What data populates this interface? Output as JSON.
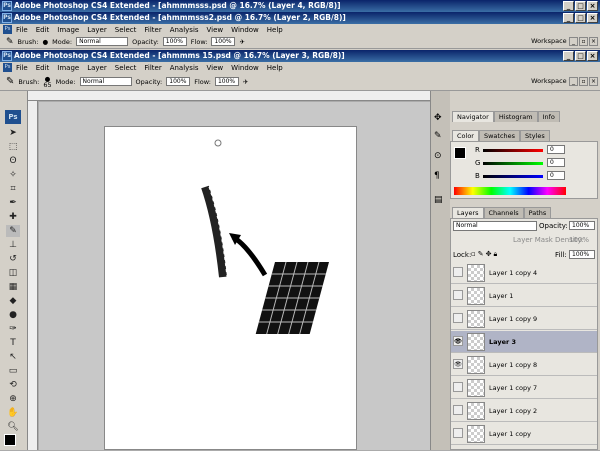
{
  "windows": [
    {
      "title": "Adobe Photoshop CS4 Extended - [ahmmmsss.psd @ 16.7% (Layer 4, RGB/8)]"
    },
    {
      "title": "Adobe Photoshop CS4 Extended - [ahmmmsss2.psd @ 16.7% (Layer 2, RGB/8)]"
    },
    {
      "title": "Adobe Photoshop CS4 Extended - [ahmmms 15.psd @ 16.7% (Layer 3, RGB/8)]"
    }
  ],
  "menu": [
    "File",
    "Edit",
    "Image",
    "Layer",
    "Select",
    "Filter",
    "Analysis",
    "View",
    "Window",
    "Help"
  ],
  "options": {
    "brush_label": "Brush:",
    "brush_size": "65",
    "mode_label": "Mode:",
    "mode_value": "Normal",
    "opacity_label": "Opacity:",
    "opacity_value": "100%",
    "flow_label": "Flow:",
    "flow_value": "100%",
    "workspace": "Workspace ▾"
  },
  "navigator_tabs": [
    "Navigator",
    "Histogram",
    "Info"
  ],
  "color_tabs": [
    "Color",
    "Swatches",
    "Styles"
  ],
  "color": {
    "r_label": "R",
    "g_label": "G",
    "b_label": "B",
    "r": "0",
    "g": "0",
    "b": "0"
  },
  "layers_tabs": [
    "Layers",
    "Channels",
    "Paths"
  ],
  "layers": {
    "blend_mode": "Normal",
    "opacity_label": "Opacity:",
    "opacity": "100%",
    "mask_label": "Layer Mask Density:",
    "mask_value": "100%",
    "lock_label": "Lock:",
    "fill_label": "Fill:",
    "fill": "100%",
    "items": [
      "Layer 1 copy 4",
      "Layer 1",
      "Layer 1 copy 9",
      "Layer 3",
      "Layer 1 copy 8",
      "Layer 1 copy 7",
      "Layer 1 copy 2",
      "Layer 1 copy"
    ]
  },
  "colors": {
    "titlebar": "#0a246a",
    "selected_layer": "#b0b4c6"
  }
}
